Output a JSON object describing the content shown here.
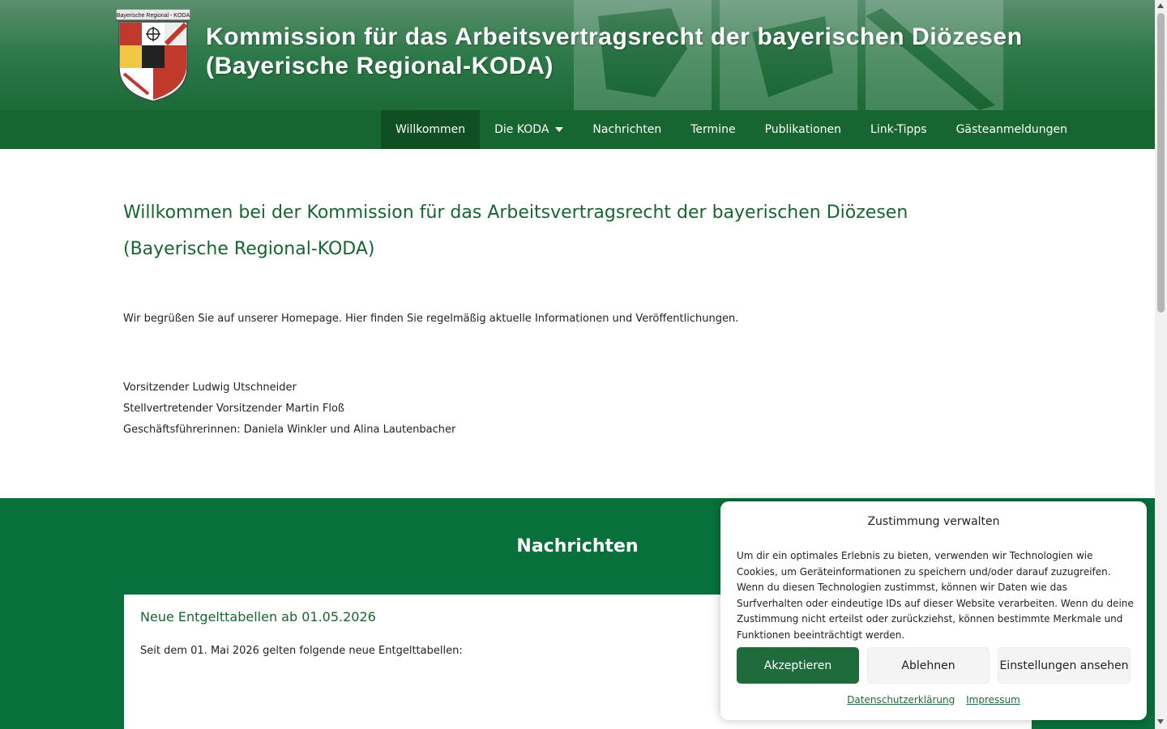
{
  "header": {
    "crest_text": "Bayerische Regional - KODA",
    "title_line1": "Kommission für das Arbeitsvertragsrecht der bayerischen Diözesen",
    "title_line2": "(Bayerische Regional-KODA)"
  },
  "nav": {
    "items": [
      {
        "label": "Willkommen",
        "active": true
      },
      {
        "label": "Die KODA",
        "has_dropdown": true
      },
      {
        "label": "Nachrichten"
      },
      {
        "label": "Termine"
      },
      {
        "label": "Publikationen"
      },
      {
        "label": "Link-Tipps"
      },
      {
        "label": "Gästeanmeldungen"
      }
    ]
  },
  "main": {
    "title_line1": "Willkommen bei der Kommission für das Arbeitsvertragsrecht der bayerischen Diözesen",
    "title_line2": "(Bayerische Regional-KODA)",
    "intro": "Wir begrüßen Sie auf unserer Homepage. Hier finden Sie regelmäßig aktuelle Informationen und Veröffentlichungen.",
    "people": [
      "Vorsitzender Ludwig Utschneider",
      "Stellvertretender Vorsitzender Martin Floß",
      "Geschäftsführerinnen: Daniela Winkler und Alina Lautenbacher"
    ]
  },
  "news": {
    "heading": "Nachrichten",
    "card_title": "Neue Entgelttabellen ab 01.05.2026",
    "card_text": "Seit dem 01. Mai 2026 gelten folgende neue Entgelttabellen:"
  },
  "consent": {
    "title": "Zustimmung verwalten",
    "text": "Um dir ein optimales Erlebnis zu bieten, verwenden wir Technologien wie Cookies, um Geräteinformationen zu speichern und/oder darauf zuzugreifen. Wenn du diesen Technologien zustimmst, können wir Daten wie das Surfverhalten oder eindeutige IDs auf dieser Website verarbeiten. Wenn du deine Zustimmung nicht erteilst oder zurückziehst, können bestimmte Merkmale und Funktionen beeinträchtigt werden.",
    "accept_label": "Akzeptieren",
    "deny_label": "Ablehnen",
    "prefs_label": "Einstellungen ansehen",
    "privacy_link": "Datenschutzerklärung",
    "imprint_link": "Impressum"
  },
  "colors": {
    "brand_green": "#176530",
    "news_green": "#08703a",
    "accept_green": "#1f6b3b"
  }
}
